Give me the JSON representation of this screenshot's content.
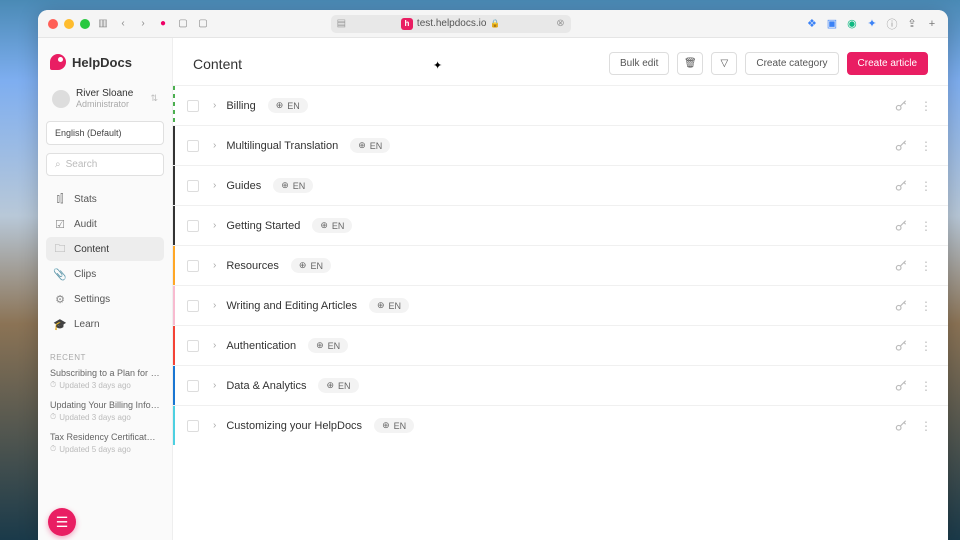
{
  "browser": {
    "url": "test.helpdocs.io"
  },
  "brand": "HelpDocs",
  "user": {
    "name": "River Sloane",
    "role": "Administrator"
  },
  "language_selector": "English (Default)",
  "search_placeholder": "Search",
  "nav": {
    "stats": "Stats",
    "audit": "Audit",
    "content": "Content",
    "clips": "Clips",
    "settings": "Settings",
    "learn": "Learn"
  },
  "recent": {
    "header": "RECENT",
    "items": [
      {
        "title": "Subscribing to a Plan for the …",
        "meta": "Updated 3 days ago"
      },
      {
        "title": "Updating Your Billing Informa…",
        "meta": "Updated 3 days ago"
      },
      {
        "title": "Tax Residency Certificates a…",
        "meta": "Updated 5 days ago"
      }
    ]
  },
  "header": {
    "title": "Content",
    "bulk_edit": "Bulk edit",
    "create_category": "Create category",
    "create_article": "Create article"
  },
  "lang_badge": "EN",
  "categories": [
    {
      "title": "Billing",
      "stripe": "green"
    },
    {
      "title": "Multilingual Translation",
      "stripe": "dark"
    },
    {
      "title": "Guides",
      "stripe": "dark"
    },
    {
      "title": "Getting Started",
      "stripe": "dark"
    },
    {
      "title": "Resources",
      "stripe": "orange"
    },
    {
      "title": "Writing and Editing Articles",
      "stripe": "pink"
    },
    {
      "title": "Authentication",
      "stripe": "red"
    },
    {
      "title": "Data & Analytics",
      "stripe": "blue"
    },
    {
      "title": "Customizing your HelpDocs",
      "stripe": "cyan"
    }
  ]
}
